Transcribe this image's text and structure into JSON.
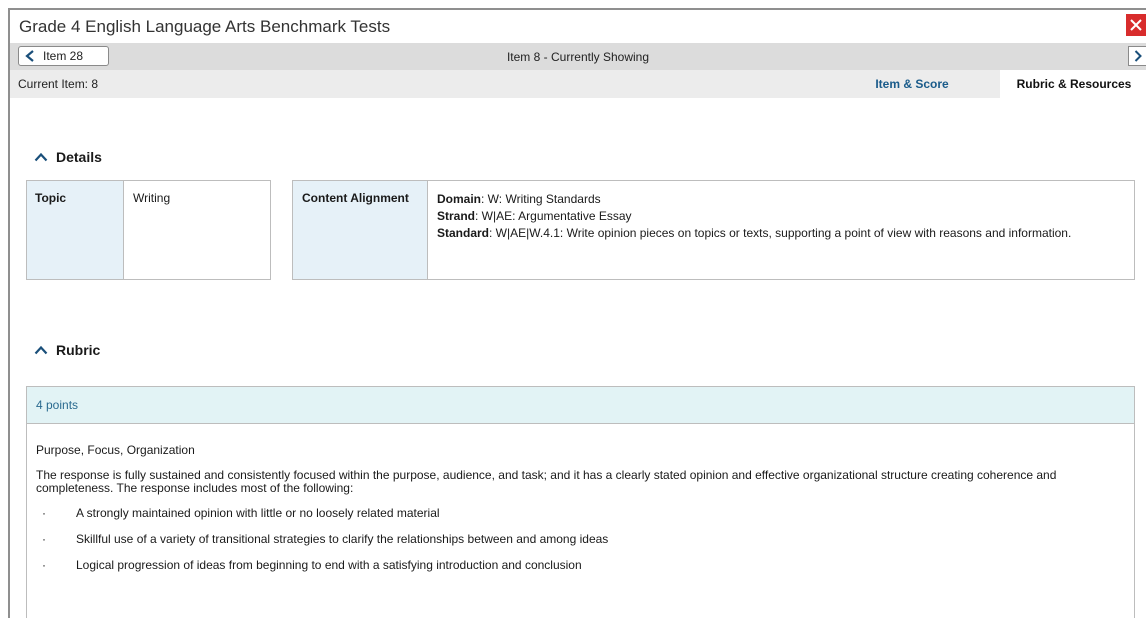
{
  "window": {
    "title": "Grade 4 English Language Arts Benchmark Tests"
  },
  "nav": {
    "prev_label": "Item 28",
    "center_label": "Item 8 - Currently Showing"
  },
  "tabs": {
    "current_item": "Current Item: 8",
    "item_score": "Item & Score",
    "rubric_resources": "Rubric & Resources"
  },
  "details": {
    "heading": "Details",
    "topic_label": "Topic",
    "topic_value": "Writing",
    "alignment_label": "Content Alignment",
    "domain_label": "Domain",
    "domain_value": ": W: Writing Standards",
    "strand_label": "Strand",
    "strand_value": ": W|AE: Argumentative Essay",
    "standard_label": "Standard",
    "standard_value": ": W|AE|W.4.1: Write opinion pieces on topics or texts, supporting a point of view with reasons and information."
  },
  "rubric": {
    "heading": "Rubric",
    "points": "4 points",
    "subtitle": "Purpose, Focus, Organization",
    "description": "The response is fully sustained and consistently focused within the purpose, audience, and task; and it has a clearly stated opinion and effective organizational structure creating coherence and completeness. The response includes most of the following:",
    "bullet_char": "·",
    "bullets": [
      "A strongly maintained opinion with little or no loosely related material",
      "Skillful use of a variety of transitional strategies to clarify the relationships between and among ideas",
      "Logical progression of ideas from beginning to end with a satisfying introduction and conclusion"
    ]
  },
  "colors": {
    "close_button": "#d82c2c",
    "tab_active_link": "#1a5b8a",
    "label_cell_bg": "#e6f1f8",
    "rubric_header_bg": "#e2f3f5"
  }
}
